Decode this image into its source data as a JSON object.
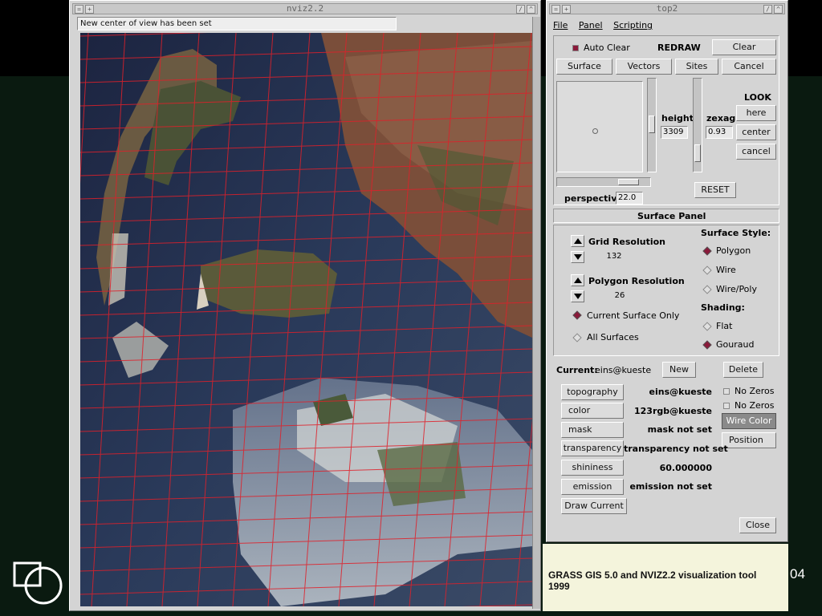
{
  "nviz_window": {
    "title": "nviz2.2",
    "status_text": "New center of view has been set"
  },
  "top2_window": {
    "title": "top2",
    "menu": [
      "File",
      "Panel",
      "Scripting"
    ],
    "auto_clear_label": "Auto Clear",
    "redraw_label": "REDRAW",
    "clear_label": "Clear",
    "panel_buttons": [
      "Surface",
      "Vectors",
      "Sites",
      "Cancel"
    ],
    "height_label": "height",
    "height_value": "3309",
    "zexag_label": "zexag",
    "zexag_value": "0.93",
    "look_label": "LOOK",
    "look_buttons": [
      "here",
      "center",
      "cancel"
    ],
    "perspective_label": "perspective",
    "perspective_value": "22.0",
    "reset_label": "RESET"
  },
  "surface_panel": {
    "title": "Surface Panel",
    "grid_resolution_label": "Grid Resolution",
    "grid_resolution_value": "132",
    "polygon_resolution_label": "Polygon  Resolution",
    "polygon_resolution_value": "26",
    "scope_options": [
      "Current Surface Only",
      "All Surfaces"
    ],
    "scope_selected": "Current Surface Only",
    "surface_style_label": "Surface Style:",
    "surface_style_options": [
      "Polygon",
      "Wire",
      "Wire/Poly"
    ],
    "surface_style_selected": "Polygon",
    "shading_label": "Shading:",
    "shading_options": [
      "Flat",
      "Gouraud"
    ],
    "shading_selected": "Gouraud",
    "current_label": "Current:",
    "current_value": "eins@kueste",
    "new_label": "New",
    "delete_label": "Delete",
    "no_zeros_1": "No Zeros",
    "no_zeros_2": "No Zeros",
    "wire_color_label": "Wire Color",
    "position_label": "Position",
    "attributes": [
      {
        "button": "topography",
        "value": "eins@kueste"
      },
      {
        "button": "color",
        "value": "123rgb@kueste"
      },
      {
        "button": "mask",
        "value": "mask not set"
      },
      {
        "button": "transparency",
        "value": "transparency not set"
      },
      {
        "button": "shininess",
        "value": "60.000000"
      },
      {
        "button": "emission",
        "value": "emission not set"
      }
    ],
    "draw_current_label": "Draw Current",
    "close_label": "Close"
  },
  "caption": {
    "line1": "GRASS GIS 5.0 and NVIZ2.2 visualization tool",
    "line2": "1999"
  },
  "page_number": "04",
  "colors": {
    "grid_line": "#e0202a",
    "water": "#1f2a48",
    "land": "#8a5a44",
    "radio_on": "#8a1a3a",
    "caption_bg": "#f4f4dc"
  }
}
